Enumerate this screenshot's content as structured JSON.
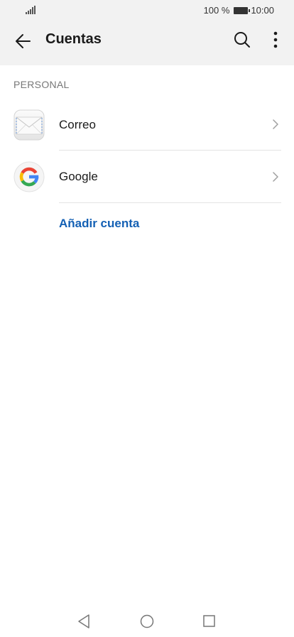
{
  "status_bar": {
    "battery_text": "100 %",
    "time": "10:00"
  },
  "app_bar": {
    "title": "Cuentas",
    "icons": [
      "back-arrow-icon",
      "search-icon",
      "more-vert-icon"
    ]
  },
  "section": {
    "label": "PERSONAL"
  },
  "accounts": [
    {
      "label": "Correo",
      "icon": "mail-envelope-icon"
    },
    {
      "label": "Google",
      "icon": "google-logo-icon"
    }
  ],
  "add_account_label": "Añadir cuenta",
  "colors": {
    "accent": "#1460b4",
    "header_bg": "#f2f2f2"
  },
  "nav_bar": {
    "icons": [
      "nav-back-icon",
      "nav-home-icon",
      "nav-recents-icon"
    ]
  }
}
